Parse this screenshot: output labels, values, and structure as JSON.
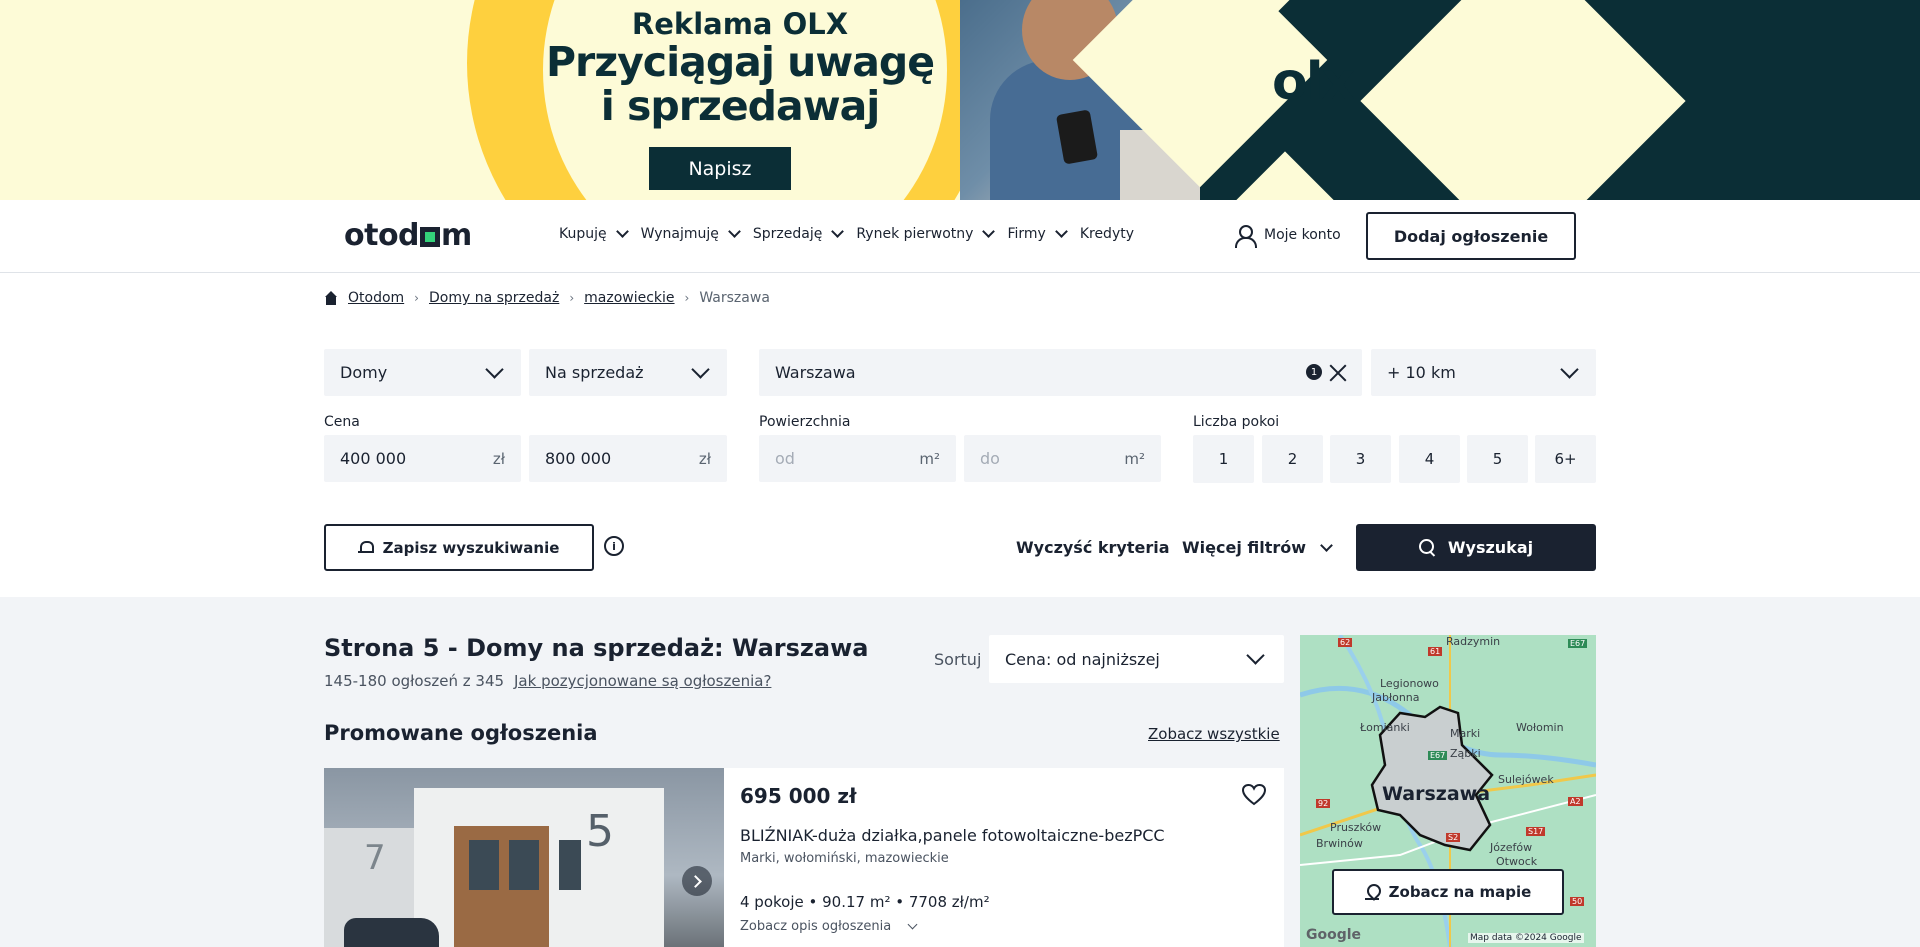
{
  "banner": {
    "headline": "Reklama OLX",
    "tagline_1": "Przyciągaj uwagę",
    "tagline_2": "i sprzedawaj",
    "cta": "Napisz",
    "logo": "olx",
    "colors": {
      "background": "#fdfbd7",
      "accent": "#fed03e",
      "dark": "#0b2e36"
    }
  },
  "header": {
    "brand_left": "otod",
    "brand_right": "m",
    "nav": [
      {
        "label": "Kupuję",
        "has_dropdown": true
      },
      {
        "label": "Wynajmuję",
        "has_dropdown": true
      },
      {
        "label": "Sprzedaję",
        "has_dropdown": true
      },
      {
        "label": "Rynek pierwotny",
        "has_dropdown": true
      },
      {
        "label": "Firmy",
        "has_dropdown": true
      },
      {
        "label": "Kredyty",
        "has_dropdown": false
      }
    ],
    "account_label": "Moje konto",
    "add_listing_label": "Dodaj ogłoszenie"
  },
  "breadcrumb": {
    "items": [
      "Otodom",
      "Domy na sprzedaż",
      "mazowieckie"
    ],
    "current": "Warszawa"
  },
  "filters": {
    "property_type": "Domy",
    "transaction": "Na sprzedaż",
    "location": "Warszawa",
    "location_count": "1",
    "radius": "+ 10 km",
    "price_label": "Cena",
    "price_from": "400 000",
    "price_to": "800 000",
    "currency": "zł",
    "area_label": "Powierzchnia",
    "area_from_placeholder": "od",
    "area_to_placeholder": "do",
    "area_unit": "m²",
    "rooms_label": "Liczba pokoi",
    "rooms": [
      "1",
      "2",
      "3",
      "4",
      "5",
      "6+"
    ],
    "save_search": "Zapisz wyszukiwanie",
    "info": "i",
    "clear": "Wyczyść kryteria",
    "more_filters": "Więcej filtrów",
    "search": "Wyszukaj"
  },
  "results": {
    "title": "Strona 5 - Domy na sprzedaż: Warszawa",
    "count": "145-180 ogłoszeń z 345",
    "ranking_link": "Jak pozycjonowane są ogłoszenia?",
    "sort_label": "Sortuj",
    "sort_value": "Cena: od najniższej",
    "promoted_title": "Promowane ogłoszenia",
    "see_all": "Zobacz wszystkie"
  },
  "listing": {
    "price": "695 000 zł",
    "title": "BLIŹNIAK-duża działka,panele fotowoltaiczne-bezPCC",
    "location": "Marki, wołomiński, mazowieckie",
    "specs": "4 pokoje • 90.17 m² • 7708 zł/m²",
    "description_toggle": "Zobacz opis ogłoszenia",
    "photo_number_main": "5",
    "photo_number_side": "7"
  },
  "map": {
    "city": "Warszawa",
    "places": [
      {
        "name": "Radzymin"
      },
      {
        "name": "Legionowo"
      },
      {
        "name": "Jabłonna"
      },
      {
        "name": "Łomianki"
      },
      {
        "name": "Marki"
      },
      {
        "name": "Ząbki"
      },
      {
        "name": "Wołomin"
      },
      {
        "name": "Sulejówek"
      },
      {
        "name": "Pruszków"
      },
      {
        "name": "Brwinów"
      },
      {
        "name": "Józefów"
      },
      {
        "name": "Otwock"
      }
    ],
    "roads": [
      {
        "label": "62"
      },
      {
        "label": "61"
      },
      {
        "label": "E67"
      },
      {
        "label": "E67"
      },
      {
        "label": "92"
      },
      {
        "label": "A2"
      },
      {
        "label": "S17"
      },
      {
        "label": "S2"
      },
      {
        "label": "50"
      }
    ],
    "button": "Zobacz na mapie",
    "google": "Google",
    "attribution": "Map data ©2024 Google"
  }
}
